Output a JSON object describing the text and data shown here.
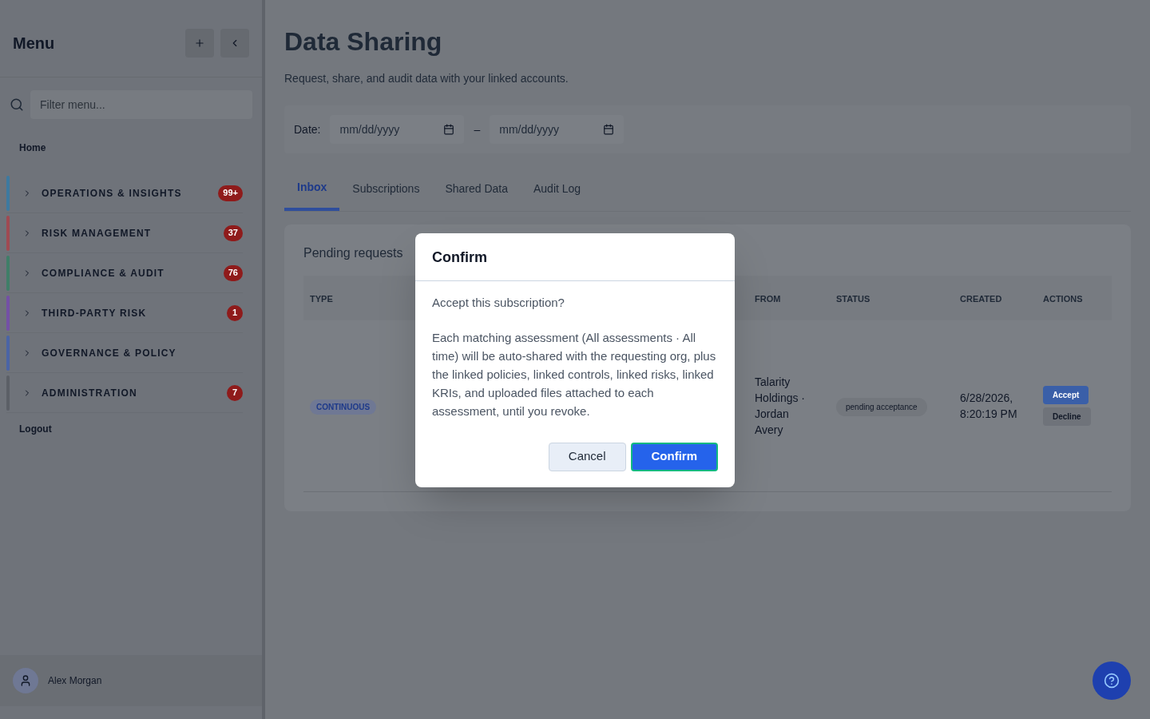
{
  "sidebar": {
    "title": "Menu",
    "filter": {
      "placeholder": "Filter menu..."
    },
    "home": "Home",
    "groups": [
      {
        "label": "OPERATIONS & INSIGHTS",
        "color": "#3d7aa0",
        "badge": "99+",
        "expanded": false
      },
      {
        "label": "RISK MANAGEMENT",
        "color": "#a04a52",
        "badge": "37",
        "expanded": false
      },
      {
        "label": "COMPLIANCE & AUDIT",
        "color": "#3f7e68",
        "badge": "76",
        "expanded": false
      },
      {
        "label": "THIRD-PARTY RISK",
        "color": "#7450a6",
        "badge": "1",
        "expanded": false
      },
      {
        "label": "GOVERNANCE & POLICY",
        "color": "#4a64a6",
        "expanded": false
      },
      {
        "label": "ADMINISTRATION",
        "color": "#5b5f66",
        "badge": "7",
        "expanded": false
      }
    ],
    "logout": "Logout",
    "user": "Alex Morgan"
  },
  "page": {
    "title": "Data Sharing",
    "subtitle": "Request, share, and audit data with your linked accounts.",
    "date_filter": {
      "label": "Date:",
      "from": {
        "placeholder": "mm/dd/yyyy"
      },
      "separator": "–",
      "to": {
        "placeholder": "mm/dd/yyyy"
      }
    },
    "tabs": [
      {
        "label": "Inbox",
        "selected": true
      },
      {
        "label": "Subscriptions",
        "selected": false
      },
      {
        "label": "Shared Data",
        "selected": false
      },
      {
        "label": "Audit Log",
        "selected": false
      }
    ],
    "panel": {
      "caption": "Pending requests",
      "table": {
        "columns": [
          "TYPE",
          "FROM",
          "STATUS",
          "CREATED",
          "ACTIONS"
        ],
        "rows": [
          {
            "type": "CONTINUOUS",
            "from": "Talarity Holdings · Jordan Avery",
            "status": "pending acceptance",
            "created": "6/28/2026, 8:20:19 PM",
            "actions": [
              "Accept",
              "Decline"
            ]
          }
        ]
      }
    }
  },
  "dialog": {
    "title": "Confirm",
    "question": "Accept this subscription?",
    "message": "Each matching assessment (All assessments · All time) will be auto-shared with the requesting org, plus the linked policies, linked controls, linked risks, linked KRIs, and uploaded files attached to each assessment, until you revoke.",
    "buttons": [
      {
        "label": "Cancel",
        "kind": "secondary"
      },
      {
        "label": "Confirm",
        "kind": "primary"
      }
    ]
  }
}
